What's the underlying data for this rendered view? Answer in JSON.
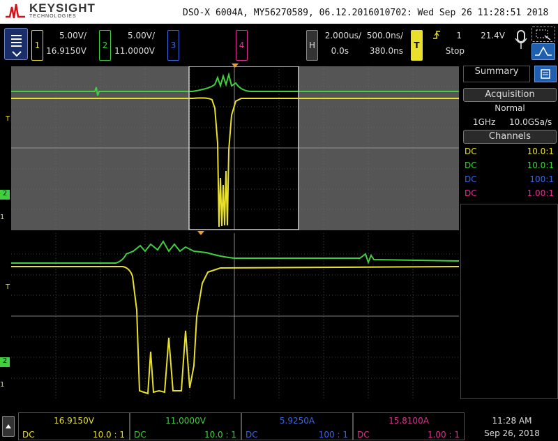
{
  "brand": {
    "name": "KEYSIGHT",
    "sub": "TECHNOLOGIES"
  },
  "instrument": "DSO-X 6004A, MY56270589, 06.12.2016010702: Wed Sep 26 11:28:51 2018",
  "channels": [
    {
      "num": "1",
      "scale": "5.00V/",
      "offset": "16.9150V",
      "color": "#e8e02a"
    },
    {
      "num": "2",
      "scale": "5.00V/",
      "offset": "11.0000V",
      "color": "#3fcf3f"
    },
    {
      "num": "3",
      "scale": "",
      "offset": "",
      "color": "#3b66e0"
    },
    {
      "num": "4",
      "scale": "",
      "offset": "",
      "color": "#e0308f"
    }
  ],
  "horizontal": {
    "label": "H",
    "timebase": "2.000us/",
    "zoom": "500.0ns/",
    "delay": "0.0s",
    "zoom_delay": "380.0ns"
  },
  "trigger": {
    "label": "T",
    "source": "1",
    "level": "21.4V",
    "state": "Stop"
  },
  "markers": {
    "trigger_level": "T",
    "ch2_ground": "2",
    "ch1_ground": "1"
  },
  "sidepanel": {
    "tab": "Summary",
    "acq_title": "Acquisition",
    "acq_mode": "Normal",
    "acq_bw": "1GHz",
    "acq_rate": "10.0GSa/s",
    "channels_title": "Channels",
    "rows": [
      {
        "coupling": "DC",
        "probe": "10.0:1",
        "color": "#e8e02a"
      },
      {
        "coupling": "DC",
        "probe": "10.0:1",
        "color": "#3fcf3f"
      },
      {
        "coupling": "DC",
        "probe": "100:1",
        "color": "#3b66e0"
      },
      {
        "coupling": "DC",
        "probe": "1.00:1",
        "color": "#e0308f"
      }
    ]
  },
  "bottom": [
    {
      "value": "16.9150V",
      "coupling": "DC",
      "probe": "10.0 : 1",
      "color": "#e8e02a"
    },
    {
      "value": "11.0000V",
      "coupling": "DC",
      "probe": "10.0 : 1",
      "color": "#3fcf3f"
    },
    {
      "value": "5.9250A",
      "coupling": "DC",
      "probe": "100 : 1",
      "color": "#3b66e0"
    },
    {
      "value": "15.8100A",
      "coupling": "DC",
      "probe": "1.00 : 1",
      "color": "#e0308f"
    }
  ],
  "clock": {
    "time": "11:28 AM",
    "date": "Sep 26, 2018"
  }
}
